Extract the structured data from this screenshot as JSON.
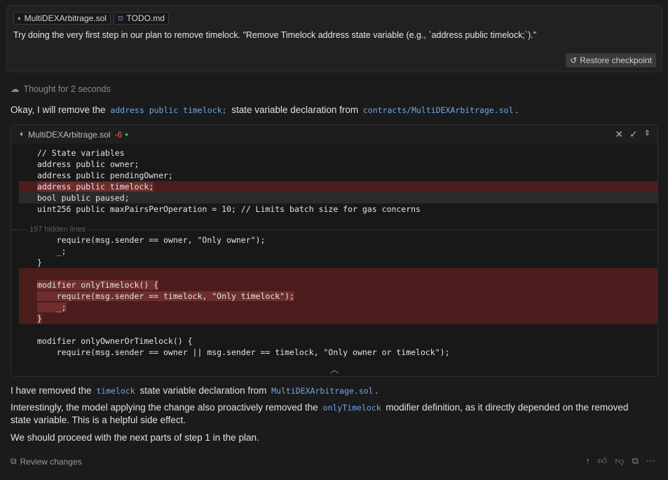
{
  "user_message": {
    "chips": [
      {
        "label": "MultiDEXArbitrage.sol"
      },
      {
        "label": "TODO.md"
      }
    ],
    "text": "Try doing the very first step in our plan to remove timelock. \"Remove Timelock address state variable (e.g., `address public timelock;`).\"",
    "restore_label": "Restore checkpoint"
  },
  "thought_label": "Thought for 2 seconds",
  "intro": {
    "before": "Okay, I will remove the",
    "code1": "address public timelock;",
    "middle": "state variable declaration from",
    "code2": "contracts/MultiDEXArbitrage.sol",
    "after": "."
  },
  "code_block": {
    "filename": "MultiDEXArbitrage.sol",
    "deleted_count": "-6",
    "hidden_label": "197 hidden lines",
    "lines_top": [
      "// State variables",
      "address public owner;",
      "address public pendingOwner;",
      "address public timelock;",
      "bool public paused;",
      "uint256 public maxPairsPerOperation = 10; // Limits batch size for gas concerns"
    ],
    "lines_bottom": [
      "    require(msg.sender == owner, \"Only owner\");",
      "    _;",
      "}",
      "",
      "modifier onlyTimelock() {",
      "    require(msg.sender == timelock, \"Only timelock\");",
      "    _;",
      "}",
      "",
      "modifier onlyOwnerOrTimelock() {",
      "    require(msg.sender == owner || msg.sender == timelock, \"Only owner or timelock\");"
    ]
  },
  "summary1": {
    "before": "I have removed the",
    "code1": "timelock",
    "middle": "state variable declaration from",
    "code2": "MultiDEXArbitrage.sol",
    "after": "."
  },
  "summary2": {
    "before": "Interestingly, the model applying the change also proactively removed the",
    "code1": "onlyTimelock",
    "after": "modifier definition, as it directly depended on the removed state variable. This is a helpful side effect."
  },
  "summary3": "We should proceed with the next parts of step 1 in the plan.",
  "footer": {
    "review_label": "Review changes"
  }
}
